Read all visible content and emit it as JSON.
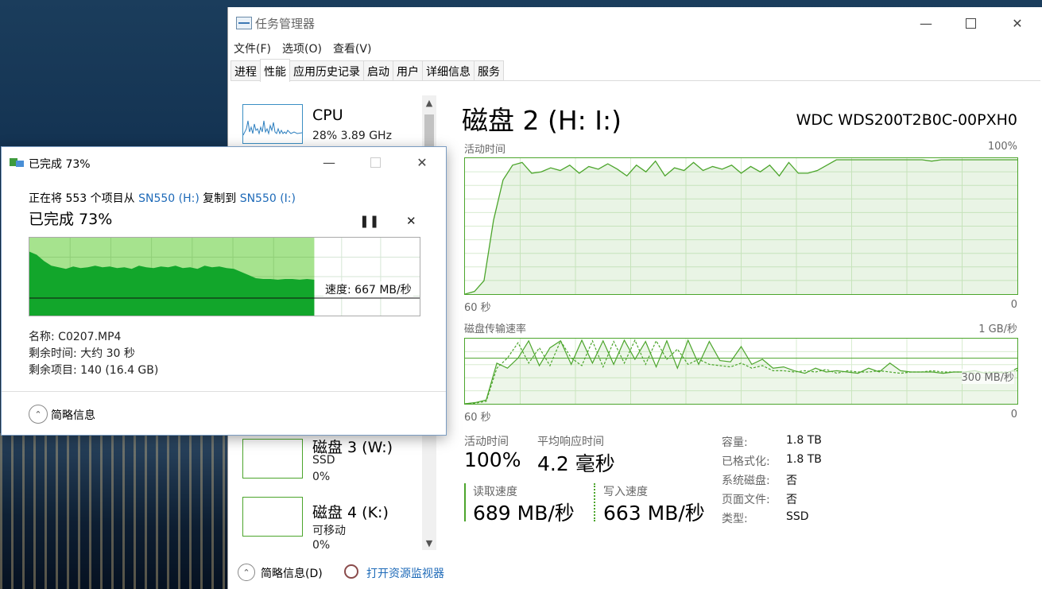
{
  "tm": {
    "title": "任务管理器",
    "menus": [
      "文件(F)",
      "选项(O)",
      "查看(V)"
    ],
    "tabs": [
      "进程",
      "性能",
      "应用历史记录",
      "启动",
      "用户",
      "详细信息",
      "服务"
    ],
    "active_tab": 1,
    "list": {
      "cpu": {
        "title": "CPU",
        "sub": "28% 3.89 GHz"
      },
      "disk3": {
        "title": "磁盘 3 (W:)",
        "type": "SSD",
        "usage": "0%"
      },
      "disk4": {
        "title": "磁盘 4 (K:)",
        "type": "可移动",
        "usage": "0%"
      }
    },
    "detail": {
      "heading": "磁盘 2 (H: I:)",
      "model": "WDC WDS200T2B0C-00PXH0",
      "active_label": "活动时间",
      "active_max": "100%",
      "time_left": "60 秒",
      "time_right": "0",
      "transfer_label": "磁盘传输速率",
      "transfer_max": "1 GB/秒",
      "transfer_mid": "300 MB/秒",
      "stats": {
        "active_time_label": "活动时间",
        "active_time": "100%",
        "avg_resp_label": "平均响应时间",
        "avg_resp": "4.2 毫秒",
        "read_label": "读取速度",
        "read": "689 MB/秒",
        "write_label": "写入速度",
        "write": "663 MB/秒"
      },
      "props": [
        {
          "k": "容量:",
          "v": "1.8 TB"
        },
        {
          "k": "已格式化:",
          "v": "1.8 TB"
        },
        {
          "k": "系统磁盘:",
          "v": "否"
        },
        {
          "k": "页面文件:",
          "v": "否"
        },
        {
          "k": "类型:",
          "v": "SSD"
        }
      ]
    },
    "footer": {
      "less": "简略信息(D)",
      "monitor": "打开资源监视器"
    }
  },
  "dialog": {
    "title": "已完成 73%",
    "line1_a": "正在将 553 个项目从 ",
    "src": "SN550 (H:)",
    "line1_b": " 复制到 ",
    "dst": "SN550 (I:)",
    "progress_text": "已完成 73%",
    "progress": 0.73,
    "speed": "速度: 667 MB/秒",
    "name": "名称: C0207.MP4",
    "remaining_time": "剩余时间: 大约 30 秒",
    "remaining_items": "剩余项目: 140 (16.4 GB)",
    "less": "简略信息"
  },
  "chart_data": [
    {
      "type": "area",
      "title": "活动时间",
      "ylim": [
        0,
        100
      ],
      "values": [
        0,
        2,
        10,
        55,
        85,
        96,
        98,
        90,
        91,
        94,
        92,
        96,
        90,
        95,
        93,
        97,
        93,
        88,
        96,
        91,
        99,
        88,
        94,
        92,
        98,
        92,
        95,
        93,
        96,
        90,
        95,
        91,
        96,
        88,
        98,
        90,
        90,
        92,
        96,
        100,
        100,
        100,
        100,
        100,
        100,
        100,
        100,
        100,
        100,
        99,
        100,
        100,
        100,
        100,
        100,
        100,
        100,
        100,
        100
      ]
    },
    {
      "type": "line",
      "title": "磁盘传输速率",
      "ylim": [
        0,
        1000
      ],
      "series": [
        {
          "name": "读取速度",
          "values": [
            0,
            20,
            60,
            640,
            560,
            720,
            990,
            600,
            880,
            990,
            620,
            1000,
            640,
            990,
            620,
            1000,
            700,
            980,
            580,
            990,
            560,
            1000,
            620,
            980,
            680,
            660,
            900,
            620,
            700,
            560,
            580,
            520,
            480,
            560,
            500,
            520,
            500,
            480,
            560,
            500,
            640,
            520,
            500,
            500,
            500,
            480,
            500,
            500,
            520,
            480,
            500,
            480,
            560
          ]
        },
        {
          "name": "写入速度",
          "values": [
            0,
            10,
            40,
            560,
            720,
            960,
            640,
            880,
            600,
            990,
            720,
            600,
            990,
            580,
            980,
            640,
            1000,
            620,
            990,
            700,
            860,
            620,
            700,
            620,
            600,
            580,
            640,
            560,
            600,
            520,
            520,
            500,
            520,
            500,
            540,
            480,
            520,
            500,
            500,
            520,
            500,
            480,
            500,
            500,
            520,
            500,
            500,
            500,
            480,
            500,
            500,
            500,
            520
          ]
        }
      ]
    },
    {
      "type": "area",
      "title": "速度",
      "progress": 0.73,
      "values": [
        820,
        780,
        700,
        640,
        620,
        600,
        630,
        610,
        620,
        640,
        620,
        630,
        610,
        620,
        600,
        640,
        620,
        610,
        630,
        620,
        640,
        610,
        620,
        600,
        640,
        620,
        630,
        610,
        600,
        560,
        520,
        480,
        470,
        470,
        460,
        470,
        470,
        460,
        470,
        460
      ]
    }
  ]
}
